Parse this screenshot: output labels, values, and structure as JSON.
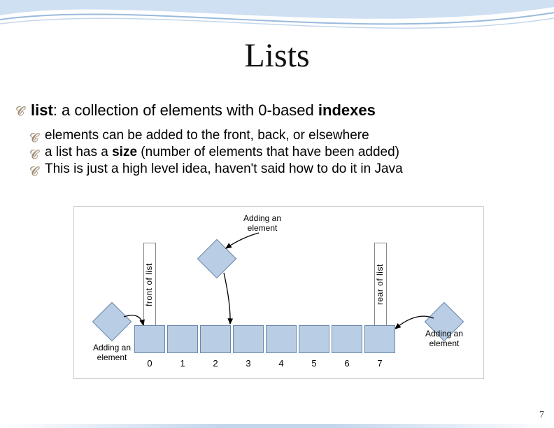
{
  "title": "Lists",
  "bullets": {
    "main": {
      "bold1": "list",
      "rest": ": a collection of elements with 0-based ",
      "bold2": "indexes"
    },
    "sub": [
      {
        "text": "elements can be added to the front, back, or elsewhere"
      },
      {
        "pre": "a list has a ",
        "bold": "size",
        "post": " (number of elements that have been added)"
      },
      {
        "text": "This is just a high level idea, haven't said how to do it in Java"
      }
    ]
  },
  "diagram": {
    "front_label": "front of list",
    "rear_label": "rear of list",
    "top_caption": "Adding an\nelement",
    "left_caption": "Adding an\nelement",
    "right_caption": "Adding an\nelement",
    "indexes": [
      "0",
      "1",
      "2",
      "3",
      "4",
      "5",
      "6",
      "7"
    ]
  },
  "page_number": "7"
}
